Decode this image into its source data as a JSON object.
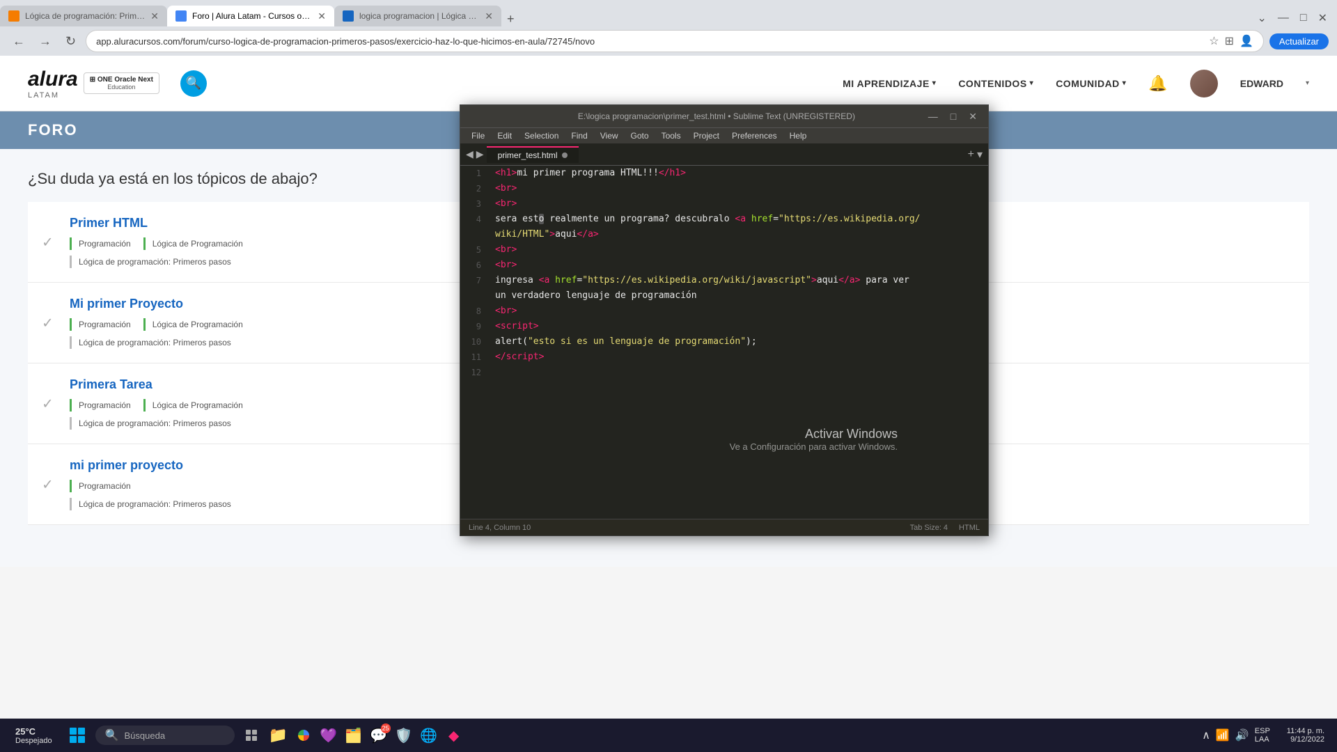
{
  "browser": {
    "tabs": [
      {
        "id": 1,
        "label": "Lógica de programación: Primer...",
        "active": false,
        "favicon_color": "orange"
      },
      {
        "id": 2,
        "label": "Foro | Alura Latam - Cursos onli...",
        "active": true,
        "favicon_color": "blue"
      },
      {
        "id": 3,
        "label": "logica programacion | Lógica de...",
        "active": false,
        "favicon_color": "blue2"
      }
    ],
    "url": "app.aluracursos.com/forum/curso-logica-de-programacion-primeros-pasos/exercicio-haz-lo-que-hicimos-en-aula/72745/novo",
    "update_btn": "Actualizar"
  },
  "header": {
    "logo": "alura",
    "logo_sub": "LATAM",
    "one_line1": "ONE Oracle Next",
    "one_line2": "Education",
    "nav_items": [
      {
        "label": "MI APRENDIZAJE",
        "has_chevron": true
      },
      {
        "label": "CONTENIDOS",
        "has_chevron": true
      },
      {
        "label": "COMUNIDAD",
        "has_chevron": true
      }
    ],
    "user_name": "EDWARD"
  },
  "forum": {
    "title": "FORO",
    "question": "¿Su duda ya está en los tópicos de abajo?",
    "items": [
      {
        "title": "Primer HTML",
        "tags": [
          "Programación",
          "Lógica de Programación"
        ],
        "course": "Lógica de programación: Primeros pasos"
      },
      {
        "title": "Mi primer Proyecto",
        "tags": [
          "Programación",
          "Lógica de Programación"
        ],
        "course": "Lógica de programación: Primeros pasos"
      },
      {
        "title": "Primera Tarea",
        "tags": [
          "Programación",
          "Lógica de Programación"
        ],
        "course": "Lógica de programación: Primeros pasos"
      },
      {
        "title": "mi primer proyecto",
        "tags": [
          "Programación"
        ],
        "course": "Lógica de programación: Primeros pasos"
      }
    ]
  },
  "sublime": {
    "title": "E:\\logica programacion\\primer_test.html • Sublime Text (UNREGISTERED)",
    "tab_name": "primer_test.html",
    "menu_items": [
      "File",
      "Edit",
      "Selection",
      "Find",
      "View",
      "Goto",
      "Tools",
      "Project",
      "Preferences",
      "Help"
    ],
    "lines": [
      {
        "num": 1,
        "html": "<span class='c-tag'>&lt;h1&gt;</span><span class='c-text'>mi primer programa HTML!!!</span><span class='c-tag'>&lt;/h1&gt;</span>"
      },
      {
        "num": 2,
        "html": "<span class='c-tag'>&lt;br&gt;</span>"
      },
      {
        "num": 3,
        "html": "<span class='c-tag'>&lt;br&gt;</span>"
      },
      {
        "num": 4,
        "html": "<span class='c-text'>sera est</span><span class='c-keyword' style='background:#555;'>o</span><span class='c-text'> realmente un programa? descubralo </span><span class='c-tag'>&lt;a </span><span class='c-attr'>href</span><span class='c-text'>=</span><span class='c-string'>\"https://es.wikipedia.org/</span>"
      },
      {
        "num": null,
        "html": "<span class='c-string'>wiki/HTML\"</span><span class='c-tag'>&gt;</span><span class='c-text'>aqui</span><span class='c-tag'>&lt;/a&gt;</span>"
      },
      {
        "num": 5,
        "html": "<span class='c-tag'>&lt;br&gt;</span>"
      },
      {
        "num": 6,
        "html": "<span class='c-tag'>&lt;br&gt;</span>"
      },
      {
        "num": 7,
        "html": "<span class='c-text'>ingresa </span><span class='c-tag'>&lt;a </span><span class='c-attr'>href</span><span class='c-text'>=</span><span class='c-string'>\"https://es.wikipedia.org/wiki/javascript\"</span><span class='c-tag'>&gt;</span><span class='c-text'>aqui</span><span class='c-tag'>&lt;/a&gt;</span><span class='c-text'> para ver</span>"
      },
      {
        "num": null,
        "html": "<span class='c-text'>un verdadero lenguaje de programación</span>"
      },
      {
        "num": 8,
        "html": "<span class='c-tag'>&lt;br&gt;</span>"
      },
      {
        "num": 9,
        "html": "<span class='c-tag'>&lt;script&gt;</span>"
      },
      {
        "num": 10,
        "html": "<span class='c-keyword'>alert</span><span class='c-text'>(</span><span class='c-string'>\"esto si es un lenguaje de programación\"</span><span class='c-text'>);</span>"
      },
      {
        "num": 11,
        "html": "<span class='c-tag'>&lt;/script&gt;</span>"
      },
      {
        "num": 12,
        "html": ""
      }
    ],
    "status_left": "Line 4, Column 10",
    "status_tab": "Tab Size: 4",
    "status_lang": "HTML"
  },
  "activate_windows": {
    "title": "Activar Windows",
    "sub": "Ve a Configuración para activar Windows."
  },
  "taskbar": {
    "weather_temp": "25°C",
    "weather_desc": "Despejado",
    "search_placeholder": "Búsqueda",
    "tray_locale": "ESP\nLAA",
    "time": "11:44 p. m.",
    "date": "9/12/2022",
    "notification_badge": "25"
  }
}
